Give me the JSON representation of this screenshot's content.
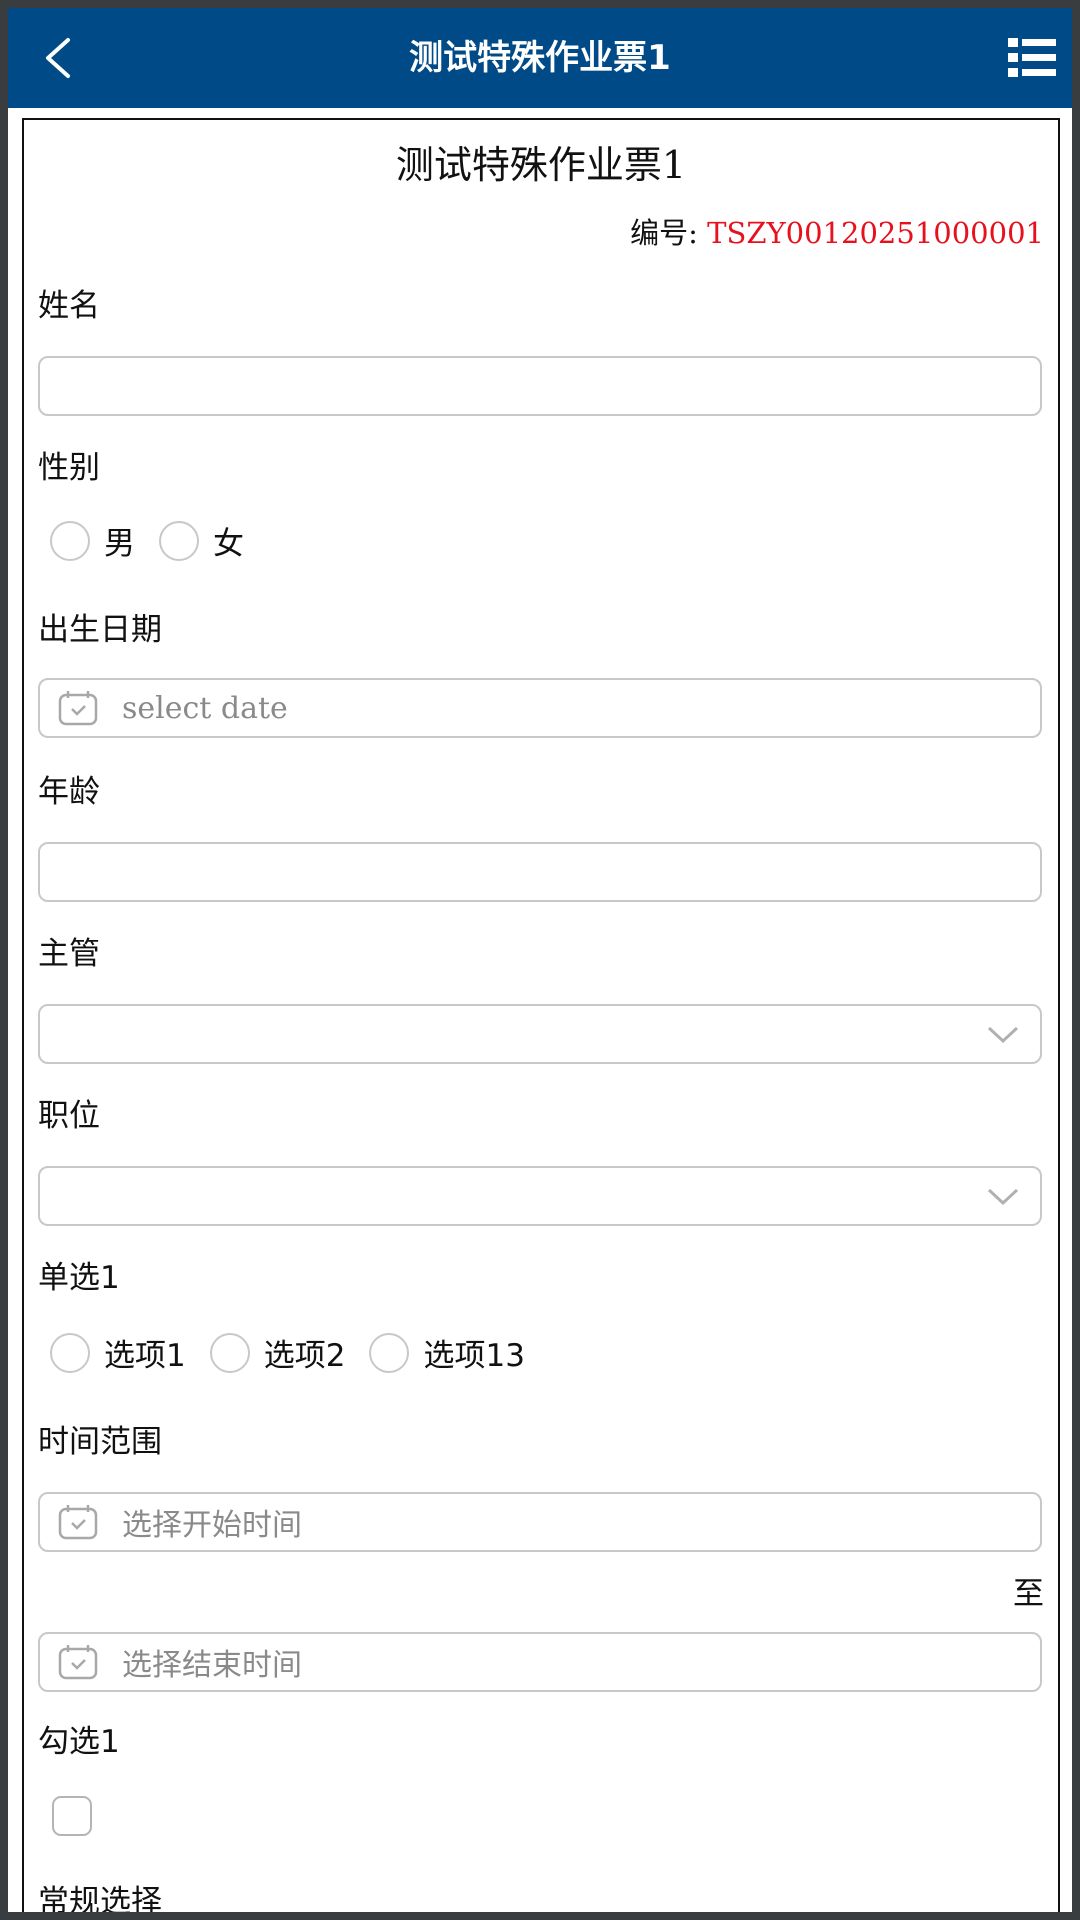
{
  "header": {
    "title": "测试特殊作业票1"
  },
  "form": {
    "title": "测试特殊作业票1",
    "code_label": "编号: ",
    "code_value": "TSZY00120251000001",
    "name_label": "姓名",
    "gender_label": "性别",
    "gender_options": [
      "男",
      "女"
    ],
    "birth_label": "出生日期",
    "birth_placeholder": "select date",
    "age_label": "年龄",
    "supervisor_label": "主管",
    "position_label": "职位",
    "single_choice_label": "单选1",
    "single_choice_options": [
      "选项1",
      "选项2",
      "选项13"
    ],
    "time_range_label": "时间范围",
    "start_time_placeholder": "选择开始时间",
    "to_label": "至",
    "end_time_placeholder": "选择结束时间",
    "checkbox_label": "勾选1",
    "regular_select_label": "常规选择"
  },
  "colors": {
    "header_bg": "#004b87",
    "code_value": "#e8101c"
  }
}
